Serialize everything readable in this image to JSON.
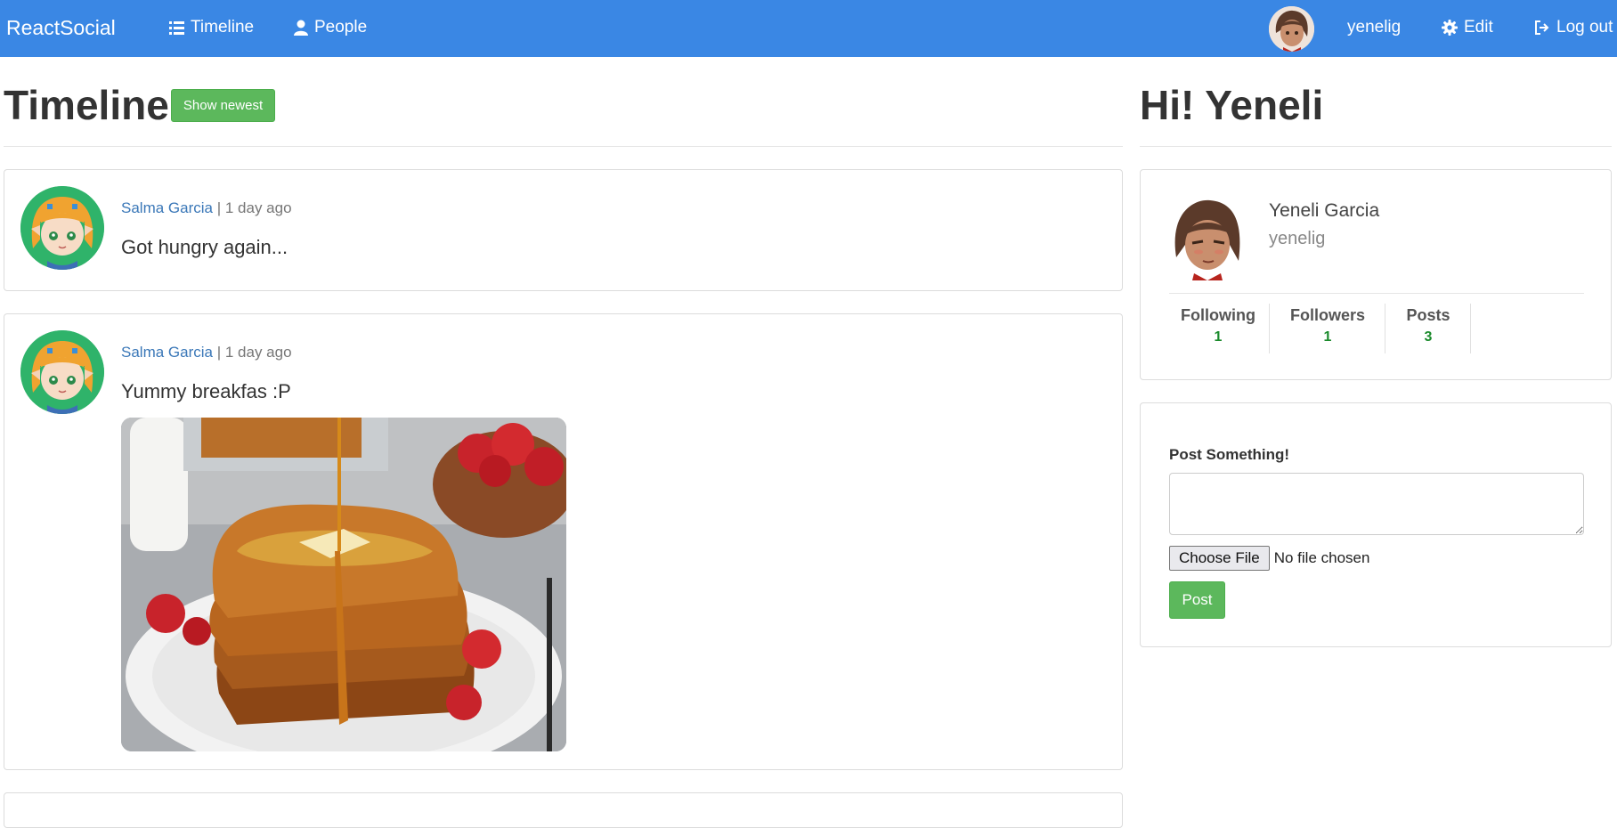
{
  "navbar": {
    "brand": "ReactSocial",
    "links": [
      {
        "label": "Timeline",
        "icon": "list-icon"
      },
      {
        "label": "People",
        "icon": "user-icon"
      }
    ],
    "username": "yenelig",
    "edit_label": "Edit",
    "logout_label": "Log out",
    "accent_color": "#3a87e4"
  },
  "timeline": {
    "title": "Timeline",
    "show_newest_label": "Show newest",
    "posts": [
      {
        "author": "Salma Garcia",
        "separator": "|",
        "time": "1 day ago",
        "text": "Got hungry again..."
      },
      {
        "author": "Salma Garcia",
        "separator": "|",
        "time": "1 day ago",
        "text": "Yummy breakfas :P",
        "image": "french-toast-photo"
      }
    ]
  },
  "sidebar": {
    "greeting": "Hi! Yeneli",
    "profile": {
      "name": "Yeneli Garcia",
      "username": "yenelig"
    },
    "stats": [
      {
        "label": "Following",
        "value": "1"
      },
      {
        "label": "Followers",
        "value": "1"
      },
      {
        "label": "Posts",
        "value": "3"
      }
    ],
    "compose": {
      "label": "Post Something!",
      "textarea_value": "",
      "file_button": "Choose File",
      "file_status": "No file chosen",
      "submit_label": "Post"
    }
  },
  "colors": {
    "success": "#5cb85c",
    "link": "#3b78b8",
    "stat_value": "#1a8a2b"
  }
}
